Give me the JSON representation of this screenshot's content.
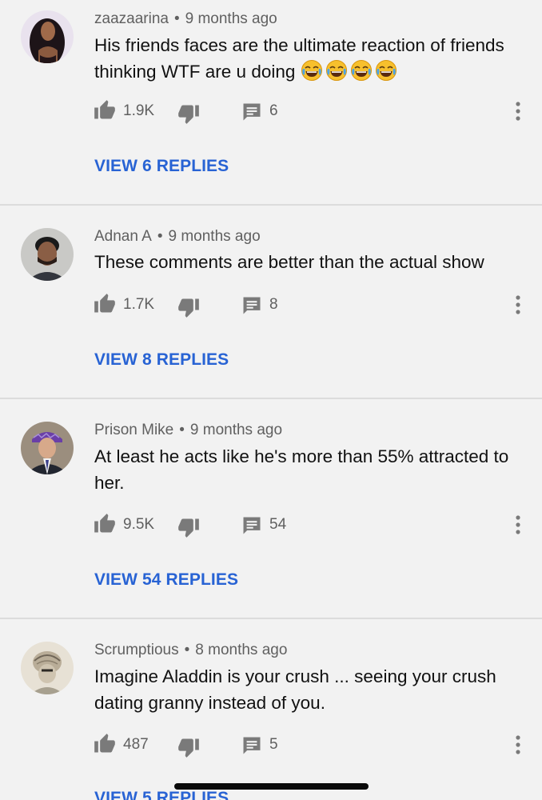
{
  "comments": [
    {
      "author": "zaazaarina",
      "separator": "•",
      "time": "9 months ago",
      "text": "His friends faces are the ultimate reaction of friends thinking WTF are u doing",
      "emoji": [
        "face-with-tears-of-joy-icon",
        "face-with-tears-of-joy-icon",
        "face-with-tears-of-joy-icon",
        "face-with-tears-of-joy-icon"
      ],
      "likes": "1.9K",
      "replies_count": "6",
      "view_replies_label": "VIEW 6 REPLIES"
    },
    {
      "author": "Adnan A",
      "separator": "•",
      "time": "9 months ago",
      "text": "These comments are better than the actual show",
      "likes": "1.7K",
      "replies_count": "8",
      "view_replies_label": "VIEW 8 REPLIES"
    },
    {
      "author": "Prison Mike",
      "separator": "•",
      "time": "9 months ago",
      "text": "At least he acts like he's more than 55% attracted to her.",
      "likes": "9.5K",
      "replies_count": "54",
      "view_replies_label": "VIEW 54 REPLIES"
    },
    {
      "author": "Scrumptious",
      "separator": "•",
      "time": "8 months ago",
      "text": "Imagine Aladdin is your crush ... seeing your crush dating granny instead of you.",
      "likes": "487",
      "replies_count": "5",
      "view_replies_label": "VIEW 5 REPLIES"
    }
  ],
  "colors": {
    "background": "#f2f2f2",
    "link": "#2863d4",
    "meta_text": "#606060",
    "body_text": "#111111",
    "icon": "#7a7a7a",
    "divider": "#dcdcdc"
  },
  "icons": {
    "like": "thumbs-up-icon",
    "dislike": "thumbs-down-icon",
    "reply": "comment-icon",
    "more": "more-vert-icon"
  }
}
